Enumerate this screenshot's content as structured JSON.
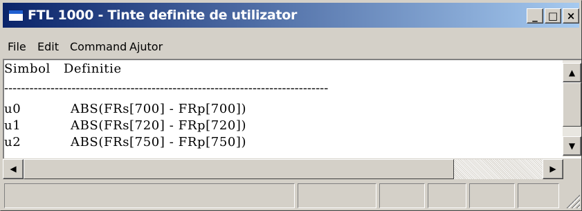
{
  "window": {
    "title": "FTL 1000 - Tinte definite de utilizator",
    "controls": {
      "minimize": "_",
      "maximize": "□",
      "close": "×"
    }
  },
  "menu": [
    {
      "label": "File"
    },
    {
      "label": "Edit"
    },
    {
      "label": "Command"
    },
    {
      "label": "Ajutor"
    }
  ],
  "content": {
    "header_line": "Simbol   Definitie",
    "separator": "-----------------------------------------------------------------------------",
    "rows": [
      {
        "symbol": "u0",
        "definition": "ABS(FRs[700] - FRp[700])"
      },
      {
        "symbol": "u1",
        "definition": "ABS(FRs[720] - FRp[720])"
      },
      {
        "symbol": "u2",
        "definition": "ABS(FRs[750] - FRp[750])"
      }
    ]
  },
  "scrollbars": {
    "vertical": {
      "up": "▲",
      "down": "▼"
    },
    "horizontal": {
      "left": "◀",
      "right": "▶"
    }
  },
  "icons": {
    "app": "app-window-icon",
    "grip": "resize-grip-icon"
  }
}
